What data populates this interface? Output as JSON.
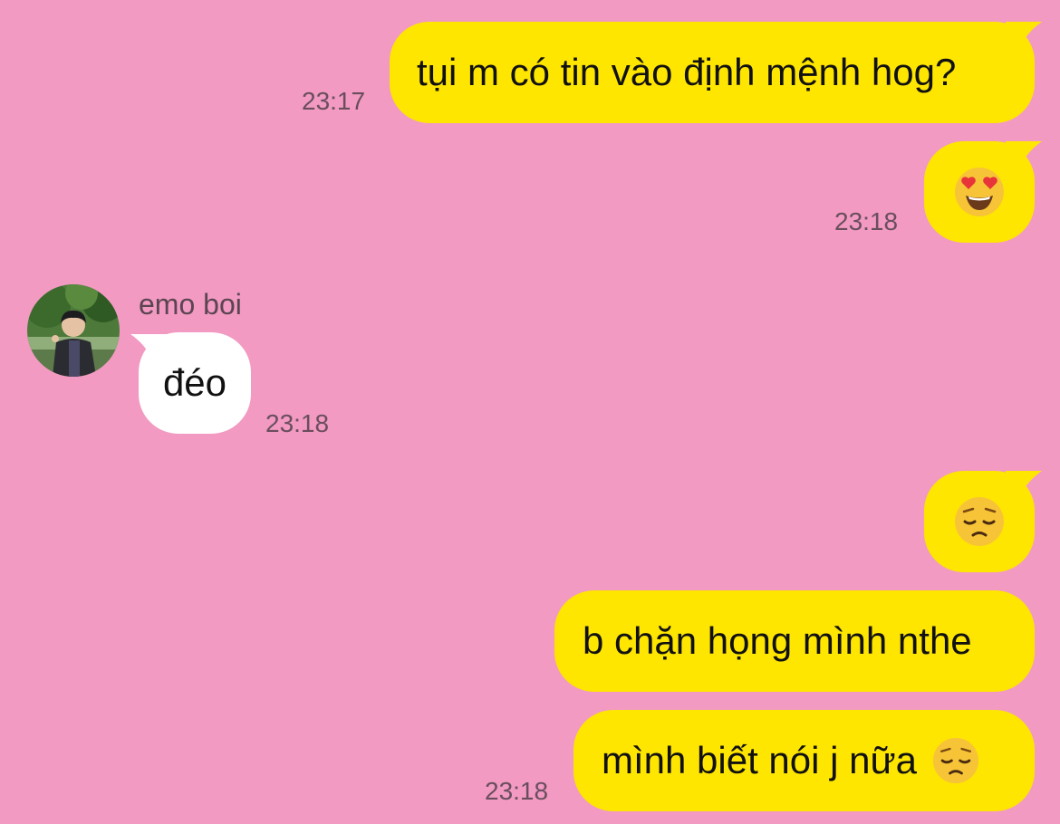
{
  "chat": {
    "messages": [
      {
        "sender": "me",
        "text": "tụi m có tin vào định mệnh hog?",
        "time": "23:17"
      },
      {
        "sender": "me",
        "emoji": "heart-eyes-emoji",
        "time": "23:18"
      },
      {
        "sender": "emo boi",
        "text": "đéo",
        "time": "23:18"
      },
      {
        "sender": "me",
        "emoji": "pensive-face-emoji"
      },
      {
        "sender": "me",
        "text": "b chặn họng mình nthe"
      },
      {
        "sender": "me",
        "text": "mình biết nói j nữa",
        "trailing_emoji": "pensive-face-emoji",
        "time": "23:18"
      }
    ],
    "contact": {
      "name": "emo boi",
      "avatar_icon": "profile-photo"
    }
  },
  "colors": {
    "background": "#f29ac1",
    "my_bubble": "#ffe600",
    "their_bubble": "#ffffff",
    "timestamp": "#6a4e5e"
  }
}
